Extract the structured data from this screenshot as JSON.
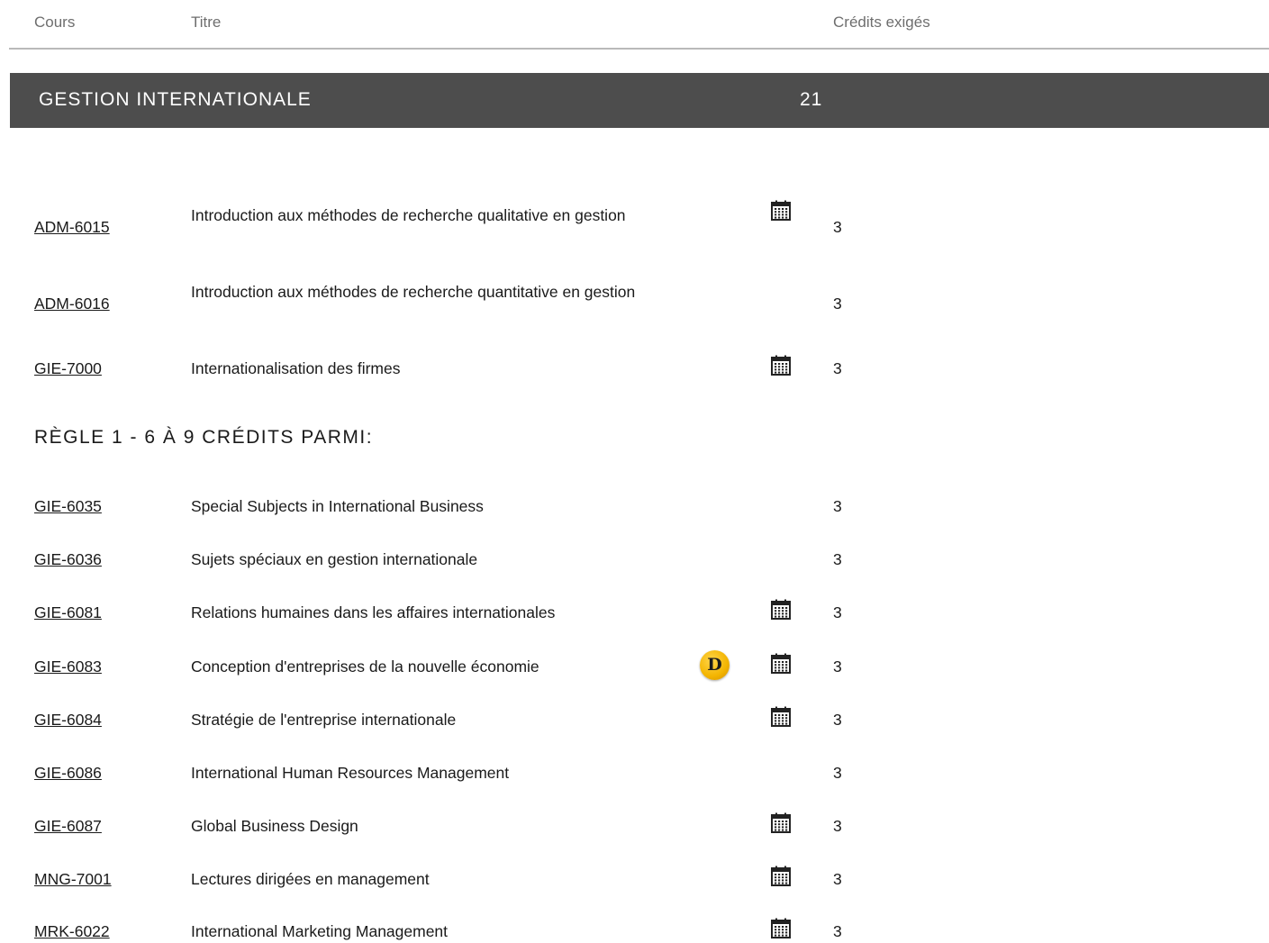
{
  "header": {
    "col_course": "Cours",
    "col_title": "Titre",
    "col_credits": "Crédits exigés"
  },
  "section": {
    "name": "GESTION INTERNATIONALE",
    "credits": "21"
  },
  "group1": [
    {
      "code": "ADM-6015",
      "title": "Introduction aux méthodes de recherche qualitative en gestion",
      "credits": "3",
      "calendar": true
    },
    {
      "code": "ADM-6016",
      "title": "Introduction aux méthodes de recherche quantitative en gestion",
      "credits": "3",
      "calendar": false
    },
    {
      "code": "GIE-7000",
      "title": "Internationalisation des firmes",
      "credits": "3",
      "calendar": true
    }
  ],
  "rule1": {
    "label": "RÈGLE 1 - 6 À 9 CRÉDITS PARMI:"
  },
  "group2": [
    {
      "code": "GIE-6035",
      "title": "Special Subjects in International Business",
      "credits": "3",
      "calendar": false
    },
    {
      "code": "GIE-6036",
      "title": "Sujets spéciaux en gestion internationale",
      "credits": "3",
      "calendar": false
    },
    {
      "code": "GIE-6081",
      "title": "Relations humaines dans les affaires internationales",
      "credits": "3",
      "calendar": true
    },
    {
      "code": "GIE-6083",
      "title": "Conception d'entreprises de la nouvelle économie",
      "credits": "3",
      "calendar": true,
      "badge": "D"
    },
    {
      "code": "GIE-6084",
      "title": "Stratégie de l'entreprise internationale",
      "credits": "3",
      "calendar": true
    },
    {
      "code": "GIE-6086",
      "title": "International Human Resources Management",
      "credits": "3",
      "calendar": false
    },
    {
      "code": "GIE-6087",
      "title": "Global Business Design",
      "credits": "3",
      "calendar": true
    },
    {
      "code": "MNG-7001",
      "title": "Lectures dirigées en management",
      "credits": "3",
      "calendar": true
    },
    {
      "code": "MRK-6022",
      "title": "International Marketing Management",
      "credits": "3",
      "calendar": true
    }
  ],
  "icons": {
    "calendar": "calendar-icon",
    "badge": "distance-course-badge"
  },
  "colors": {
    "band_bg": "#4d4d4d",
    "badge": "#f3b400"
  }
}
